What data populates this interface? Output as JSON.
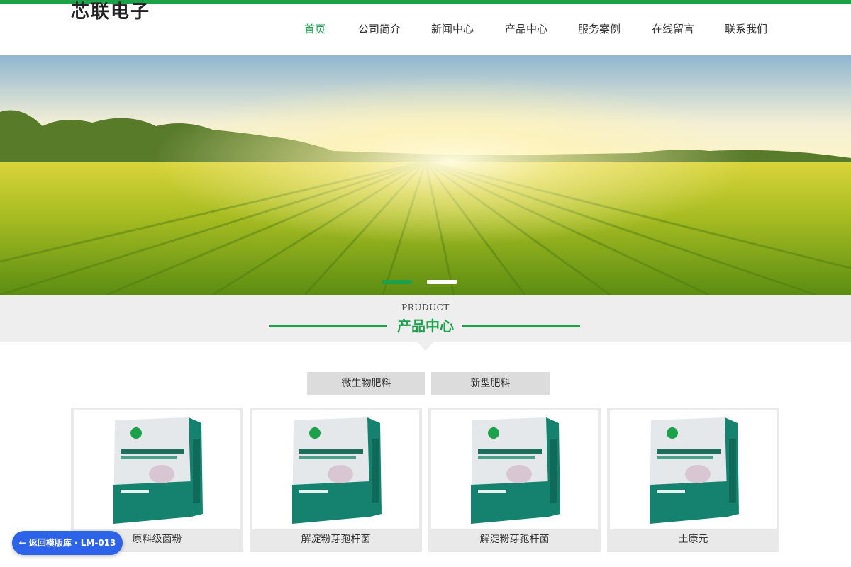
{
  "brand": {
    "logo": "芯联电子",
    "accent": "#1aa14a"
  },
  "nav": {
    "items": [
      {
        "label": "首页",
        "active": true
      },
      {
        "label": "公司简介",
        "active": false
      },
      {
        "label": "新闻中心",
        "active": false
      },
      {
        "label": "产品中心",
        "active": false
      },
      {
        "label": "服务案例",
        "active": false
      },
      {
        "label": "在线留言",
        "active": false
      },
      {
        "label": "联系我们",
        "active": false
      }
    ]
  },
  "banner": {
    "slides": 2,
    "active_slide": 1
  },
  "section": {
    "en": "PRUDUCT",
    "cn": "产品中心"
  },
  "tabs": [
    {
      "label": "微生物肥料"
    },
    {
      "label": "新型肥料"
    }
  ],
  "products": [
    {
      "name": "原料级菌粉"
    },
    {
      "name": "解淀粉芽孢杆菌"
    },
    {
      "name": "解淀粉芽孢杆菌"
    },
    {
      "name": "土康元"
    }
  ],
  "floating": {
    "back_label": "← 返回模版库 · LM-013"
  }
}
